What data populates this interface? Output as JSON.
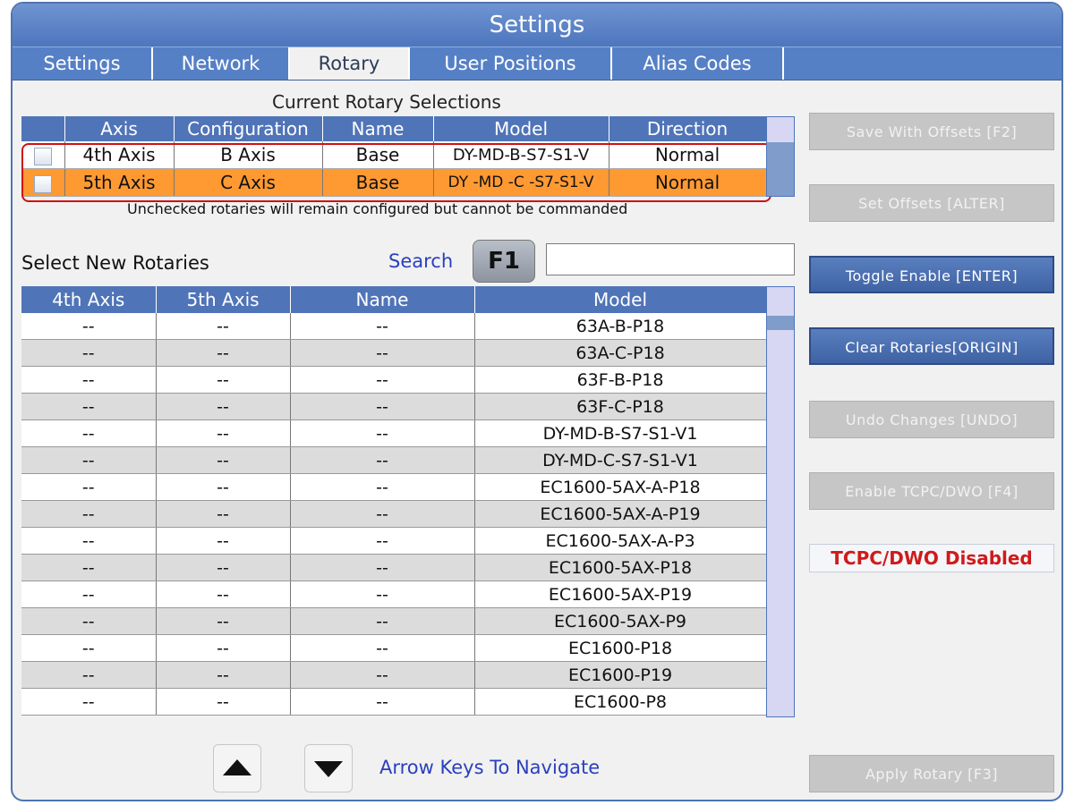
{
  "window": {
    "title": "Settings"
  },
  "tabs": [
    {
      "label": "Settings",
      "active": false
    },
    {
      "label": "Network",
      "active": false
    },
    {
      "label": "Rotary",
      "active": true
    },
    {
      "label": "User Positions",
      "active": false
    },
    {
      "label": "Alias Codes",
      "active": false
    }
  ],
  "current": {
    "title": "Current Rotary Selections",
    "headers": [
      "Axis",
      "Configuration",
      "Name",
      "Model",
      "Direction"
    ],
    "rows": [
      {
        "axis": "4th Axis",
        "configuration": "B Axis",
        "name": "Base",
        "model": "DY-MD-B-S7-S1-V",
        "direction": "Normal",
        "highlight": false
      },
      {
        "axis": "5th Axis",
        "configuration": "C Axis",
        "name": "Base",
        "model": "DY -MD -C -S7-S1-V",
        "direction": "Normal",
        "highlight": true
      }
    ],
    "note": "Unchecked rotaries will remain configured but cannot be commanded",
    "highlight_color": "#ff9a33"
  },
  "new_rotaries": {
    "title": "Select New Rotaries",
    "search_label": "Search",
    "search_key": "F1",
    "search_value": "",
    "headers": [
      "4th Axis",
      "5th Axis",
      "Name",
      "Model"
    ],
    "rows": [
      {
        "a4": "--",
        "a5": "--",
        "name": "--",
        "model": "63A-B-P18"
      },
      {
        "a4": "--",
        "a5": "--",
        "name": "--",
        "model": "63A-C-P18"
      },
      {
        "a4": "--",
        "a5": "--",
        "name": "--",
        "model": "63F-B-P18"
      },
      {
        "a4": "--",
        "a5": "--",
        "name": "--",
        "model": "63F-C-P18"
      },
      {
        "a4": "--",
        "a5": "--",
        "name": "--",
        "model": "DY-MD-B-S7-S1-V1"
      },
      {
        "a4": "--",
        "a5": "--",
        "name": "--",
        "model": "DY-MD-C-S7-S1-V1"
      },
      {
        "a4": "--",
        "a5": "--",
        "name": "--",
        "model": "EC1600-5AX-A-P18"
      },
      {
        "a4": "--",
        "a5": "--",
        "name": "--",
        "model": "EC1600-5AX-A-P19"
      },
      {
        "a4": "--",
        "a5": "--",
        "name": "--",
        "model": "EC1600-5AX-A-P3"
      },
      {
        "a4": "--",
        "a5": "--",
        "name": "--",
        "model": "EC1600-5AX-P18"
      },
      {
        "a4": "--",
        "a5": "--",
        "name": "--",
        "model": "EC1600-5AX-P19"
      },
      {
        "a4": "--",
        "a5": "--",
        "name": "--",
        "model": "EC1600-5AX-P9"
      },
      {
        "a4": "--",
        "a5": "--",
        "name": "--",
        "model": "EC1600-P18"
      },
      {
        "a4": "--",
        "a5": "--",
        "name": "--",
        "model": "EC1600-P19"
      },
      {
        "a4": "--",
        "a5": "--",
        "name": "--",
        "model": "EC1600-P8"
      }
    ]
  },
  "buttons": {
    "save_offsets": "Save With Offsets  [F2]",
    "set_offsets": "Set Offsets        [ALTER]",
    "toggle_enable": "Toggle Enable  [ENTER]",
    "clear_rotaries": "Clear Rotaries[ORIGIN]",
    "undo_changes": "Undo Changes [UNDO]",
    "enable_tcpc": "Enable TCPC/DWO [F4]",
    "apply_rotary": "Apply Rotary           [F3]"
  },
  "status": {
    "tcpc": "TCPC/DWO Disabled",
    "color": "#d01a1a"
  },
  "navigation": {
    "hint": "Arrow Keys To Navigate",
    "up_icon": "arrow-up-icon",
    "down_icon": "arrow-down-icon"
  }
}
